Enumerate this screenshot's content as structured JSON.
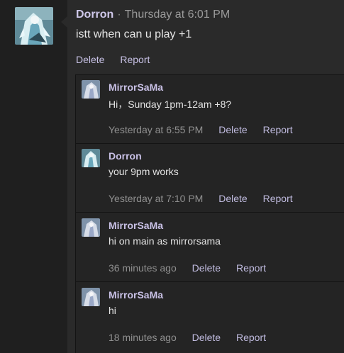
{
  "main_comment": {
    "author": "Dorron",
    "separator": "·",
    "timestamp": "Thursday at 6:01 PM",
    "body": "istt when can u play +1",
    "actions": [
      "Delete",
      "Report"
    ],
    "avatar_icon": "anime-character-avatar-icon"
  },
  "replies": [
    {
      "author": "MirrorSaMa",
      "body": "Hi，Sunday 1pm-12am +8?",
      "timestamp": "Yesterday at 6:55 PM",
      "actions": [
        "Delete",
        "Report"
      ],
      "avatar_icon": "anime-character-avatar-icon"
    },
    {
      "author": "Dorron",
      "body": "your 9pm works",
      "timestamp": "Yesterday at 7:10 PM",
      "actions": [
        "Delete",
        "Report"
      ],
      "avatar_icon": "anime-character-avatar-icon"
    },
    {
      "author": "MirrorSaMa",
      "body": "hi on main as mirrorsama",
      "timestamp": "36 minutes ago",
      "actions": [
        "Delete",
        "Report"
      ],
      "avatar_icon": "anime-character-avatar-icon"
    },
    {
      "author": "MirrorSaMa",
      "body": "hi",
      "timestamp": "18 minutes ago",
      "actions": [
        "Delete",
        "Report"
      ],
      "avatar_icon": "anime-character-avatar-icon"
    }
  ],
  "colors": {
    "background": "#2a2a2a",
    "reply_background": "#242424",
    "author": "#cfc8ea",
    "link": "#c8c2e6",
    "muted": "#9b9b9b"
  }
}
